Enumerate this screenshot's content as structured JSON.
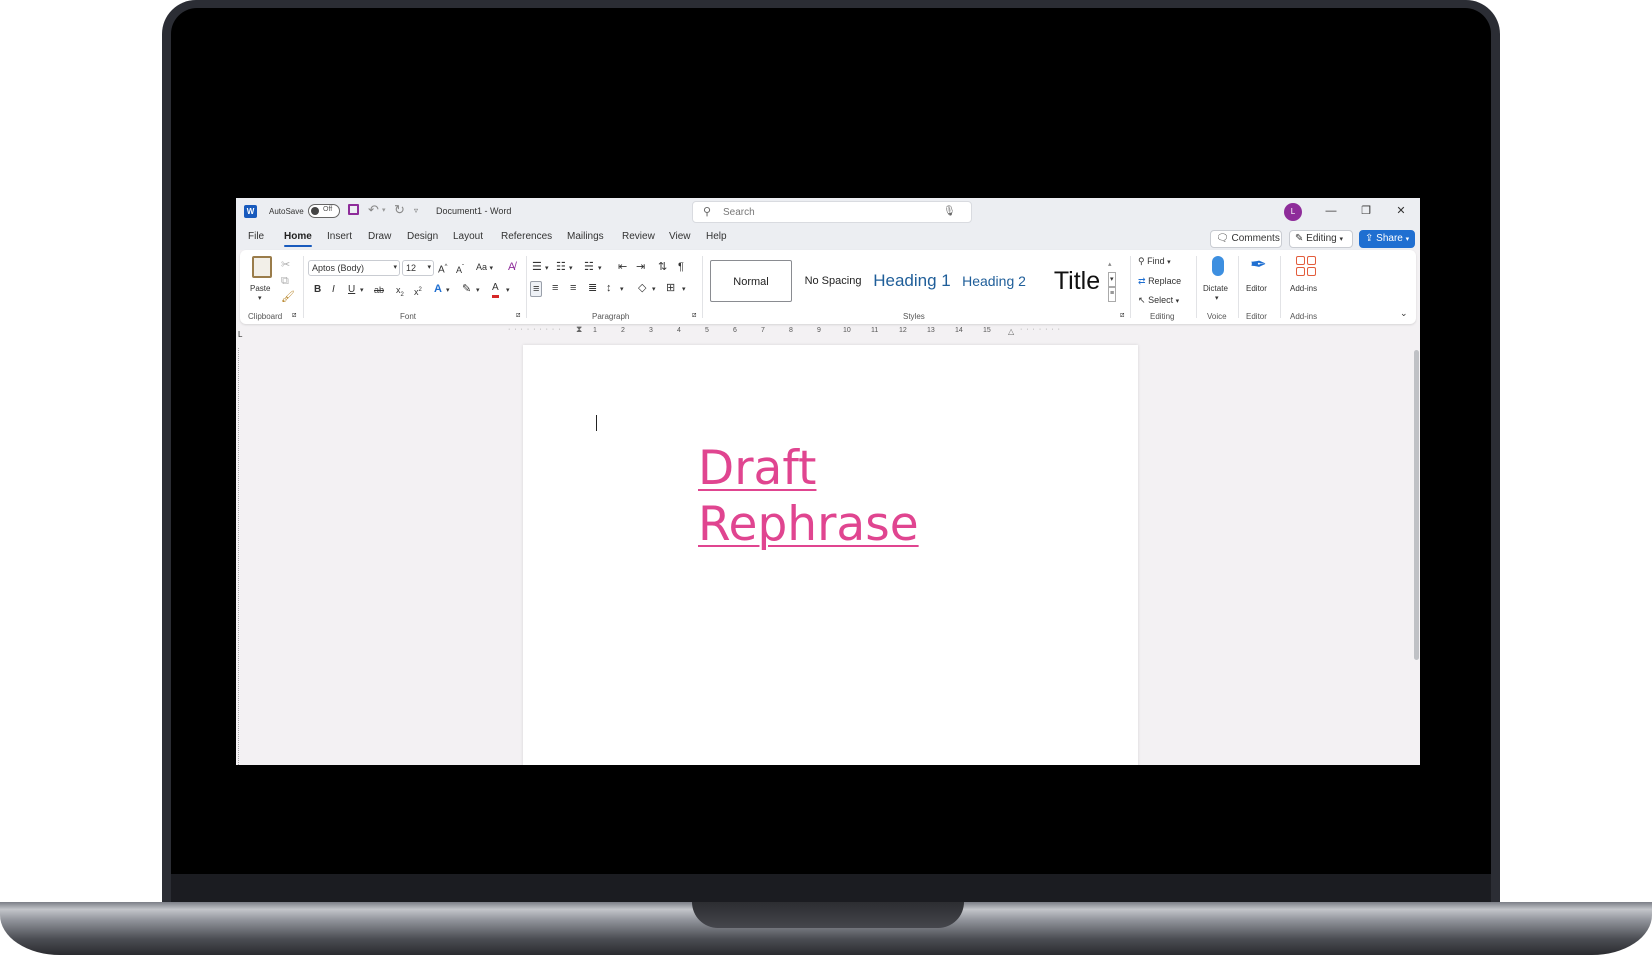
{
  "window": {
    "autosave_label": "AutoSave",
    "autosave_state": "Off",
    "document_title": "Document1 - Word",
    "search_placeholder": "Search",
    "avatar_initial": "L"
  },
  "tabs": [
    "File",
    "Home",
    "Insert",
    "Draw",
    "Design",
    "Layout",
    "References",
    "Mailings",
    "Review",
    "View",
    "Help"
  ],
  "active_tab": "Home",
  "top_buttons": {
    "comments": "Comments",
    "editing": "Editing",
    "share": "Share"
  },
  "ribbon": {
    "clipboard": {
      "paste": "Paste",
      "group": "Clipboard"
    },
    "font": {
      "name": "Aptos (Body)",
      "size": "12",
      "case": "Aa",
      "group": "Font"
    },
    "paragraph": {
      "group": "Paragraph"
    },
    "styles": {
      "items": [
        "Normal",
        "No Spacing",
        "Heading 1",
        "Heading 2",
        "Title"
      ],
      "group": "Styles"
    },
    "editing": {
      "find": "Find",
      "replace": "Replace",
      "select": "Select",
      "group": "Editing"
    },
    "voice": {
      "dictate": "Dictate",
      "group": "Voice"
    },
    "editor": {
      "label": "Editor",
      "group": "Editor"
    },
    "addins": {
      "label": "Add-ins",
      "group": "Add-ins"
    }
  },
  "ruler_numbers": [
    "1",
    "2",
    "3",
    "4",
    "5",
    "6",
    "7",
    "8",
    "9",
    "10",
    "11",
    "12",
    "13",
    "14",
    "15"
  ],
  "document": {
    "lines": [
      "Draft",
      "Rephrase"
    ]
  },
  "colors": {
    "accent": "#185abd",
    "link": "#e04590",
    "avatar": "#8e2c9a",
    "share": "#1f6fd1"
  }
}
